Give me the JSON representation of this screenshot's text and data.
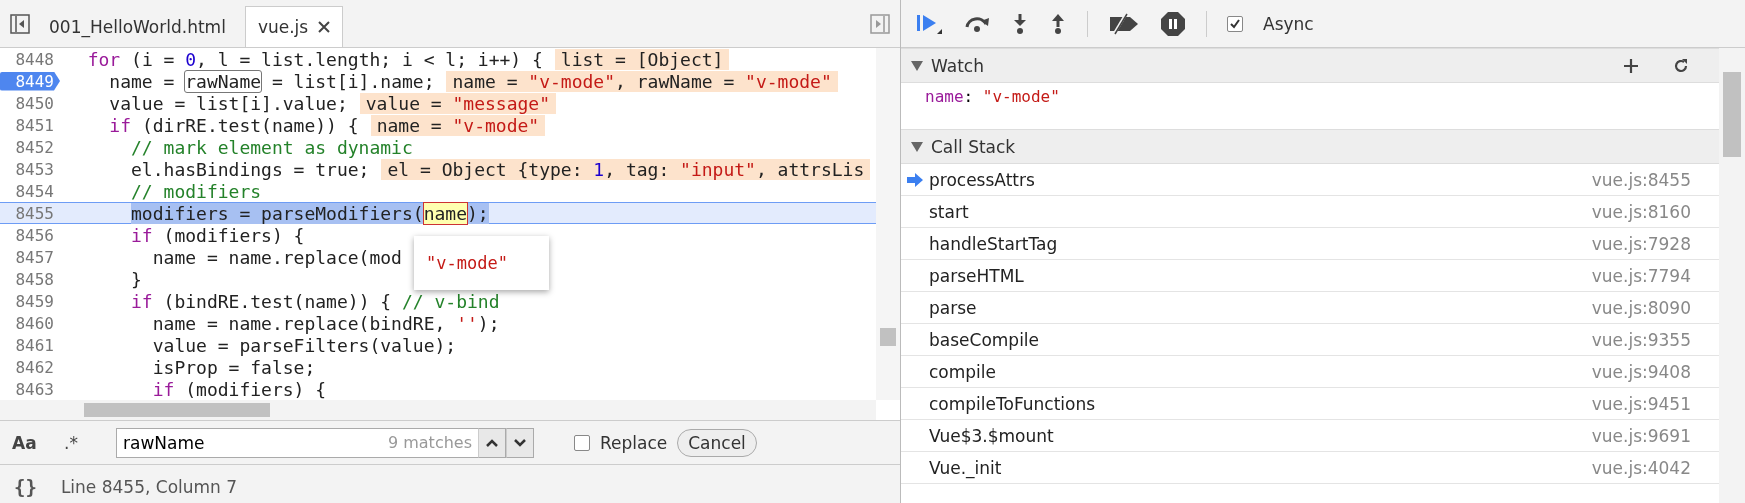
{
  "editor": {
    "tabs": [
      {
        "label": "001_HelloWorld.html",
        "selected": false,
        "closable": false
      },
      {
        "label": "vue.js",
        "selected": true,
        "closable": true
      }
    ],
    "lines": [
      {
        "number": "8448",
        "breakpoint": false,
        "current": false,
        "tokens": [
          {
            "text": "  for",
            "kind": "keyword"
          },
          {
            "text": " (i = ",
            "kind": "plain"
          },
          {
            "text": "0",
            "kind": "number"
          },
          {
            "text": ", l = list.length; i < l; i++) {",
            "kind": "plain"
          }
        ],
        "inline": [
          {
            "text": "list = [Object]",
            "kind": "plain"
          }
        ]
      },
      {
        "number": "8449",
        "breakpoint": true,
        "current": false,
        "tokens": [
          {
            "text": "    name = ",
            "kind": "plain"
          },
          {
            "text": "rawName",
            "kind": "match"
          },
          {
            "text": " = list[i].name;",
            "kind": "plain"
          }
        ],
        "inline": [
          {
            "text": "name = ",
            "kind": "plain"
          },
          {
            "text": "\"v-mode\"",
            "kind": "string"
          },
          {
            "text": ", rawName = ",
            "kind": "plain"
          },
          {
            "text": "\"v-mode\"",
            "kind": "string"
          }
        ]
      },
      {
        "number": "8450",
        "breakpoint": false,
        "current": false,
        "tokens": [
          {
            "text": "    value = list[i].value;",
            "kind": "plain"
          }
        ],
        "inline": [
          {
            "text": "value = ",
            "kind": "plain"
          },
          {
            "text": "\"message\"",
            "kind": "string"
          }
        ]
      },
      {
        "number": "8451",
        "breakpoint": false,
        "current": false,
        "tokens": [
          {
            "text": "    if",
            "kind": "keyword"
          },
          {
            "text": " (dirRE.test(name)) {",
            "kind": "plain"
          }
        ],
        "inline": [
          {
            "text": "name = ",
            "kind": "plain"
          },
          {
            "text": "\"v-mode\"",
            "kind": "string"
          }
        ]
      },
      {
        "number": "8452",
        "breakpoint": false,
        "current": false,
        "tokens": [
          {
            "text": "      // mark element as dynamic",
            "kind": "comment"
          }
        ]
      },
      {
        "number": "8453",
        "breakpoint": false,
        "current": false,
        "tokens": [
          {
            "text": "      el.hasBindings = true;",
            "kind": "plain"
          }
        ],
        "inline": [
          {
            "text": "el = Object {type: ",
            "kind": "plain"
          },
          {
            "text": "1",
            "kind": "number"
          },
          {
            "text": ", tag: ",
            "kind": "plain"
          },
          {
            "text": "\"input\"",
            "kind": "string"
          },
          {
            "text": ", attrsLis",
            "kind": "plain"
          }
        ]
      },
      {
        "number": "8454",
        "breakpoint": false,
        "current": false,
        "tokens": [
          {
            "text": "      // modifiers",
            "kind": "comment"
          }
        ]
      },
      {
        "number": "8455",
        "breakpoint": false,
        "current": true,
        "tokens": [
          {
            "text": "      modifiers = parseModifiers(",
            "kind": "selected"
          },
          {
            "text": "name",
            "kind": "hover"
          },
          {
            "text": ");",
            "kind": "selected"
          }
        ]
      },
      {
        "number": "8456",
        "breakpoint": false,
        "current": false,
        "tokens": [
          {
            "text": "      if",
            "kind": "keyword"
          },
          {
            "text": " (modifiers) {",
            "kind": "plain"
          }
        ]
      },
      {
        "number": "8457",
        "breakpoint": false,
        "current": false,
        "tokens": [
          {
            "text": "        name = name.replace(mod",
            "kind": "plain"
          }
        ]
      },
      {
        "number": "8458",
        "breakpoint": false,
        "current": false,
        "tokens": [
          {
            "text": "      }",
            "kind": "plain"
          }
        ]
      },
      {
        "number": "8459",
        "breakpoint": false,
        "current": false,
        "tokens": [
          {
            "text": "      if",
            "kind": "keyword"
          },
          {
            "text": " (bindRE.test(name)) { ",
            "kind": "plain"
          },
          {
            "text": "// v-bind",
            "kind": "comment"
          }
        ]
      },
      {
        "number": "8460",
        "breakpoint": false,
        "current": false,
        "tokens": [
          {
            "text": "        name = name.replace(bindRE, ",
            "kind": "plain"
          },
          {
            "text": "''",
            "kind": "string"
          },
          {
            "text": ");",
            "kind": "plain"
          }
        ]
      },
      {
        "number": "8461",
        "breakpoint": false,
        "current": false,
        "tokens": [
          {
            "text": "        value = parseFilters(value);",
            "kind": "plain"
          }
        ]
      },
      {
        "number": "8462",
        "breakpoint": false,
        "current": false,
        "tokens": [
          {
            "text": "        isProp = false;",
            "kind": "plain"
          }
        ]
      },
      {
        "number": "8463",
        "breakpoint": false,
        "current": false,
        "tokens": [
          {
            "text": "        if",
            "kind": "keyword"
          },
          {
            "text": " (modifiers) {",
            "kind": "plain"
          }
        ]
      }
    ],
    "tooltip": {
      "text": "\"v-mode\""
    },
    "search": {
      "case_toggle": "Aa",
      "regex_toggle": ".*",
      "value": "rawName",
      "matches": "9 matches",
      "replace": {
        "label": "Replace",
        "checked": false
      },
      "cancel": "Cancel"
    },
    "status": {
      "format_icon": "{}",
      "position": "Line 8455, Column 7"
    }
  },
  "debugger": {
    "async": {
      "label": "Async",
      "checked": true
    },
    "watch": {
      "title": "Watch",
      "expanded": true,
      "items": [
        {
          "name": "name",
          "separator": ":",
          "value": "\"v-mode\""
        }
      ]
    },
    "call_stack": {
      "title": "Call Stack",
      "expanded": true,
      "frames": [
        {
          "name": "processAttrs",
          "location": "vue.js:8455",
          "selected": true
        },
        {
          "name": "start",
          "location": "vue.js:8160",
          "selected": false
        },
        {
          "name": "handleStartTag",
          "location": "vue.js:7928",
          "selected": false
        },
        {
          "name": "parseHTML",
          "location": "vue.js:7794",
          "selected": false
        },
        {
          "name": "parse",
          "location": "vue.js:8090",
          "selected": false
        },
        {
          "name": "baseCompile",
          "location": "vue.js:9355",
          "selected": false
        },
        {
          "name": "compile",
          "location": "vue.js:9408",
          "selected": false
        },
        {
          "name": "compileToFunctions",
          "location": "vue.js:9451",
          "selected": false
        },
        {
          "name": "Vue$3.$mount",
          "location": "vue.js:9691",
          "selected": false
        },
        {
          "name": "Vue._init",
          "location": "vue.js:4042",
          "selected": false
        }
      ]
    }
  }
}
